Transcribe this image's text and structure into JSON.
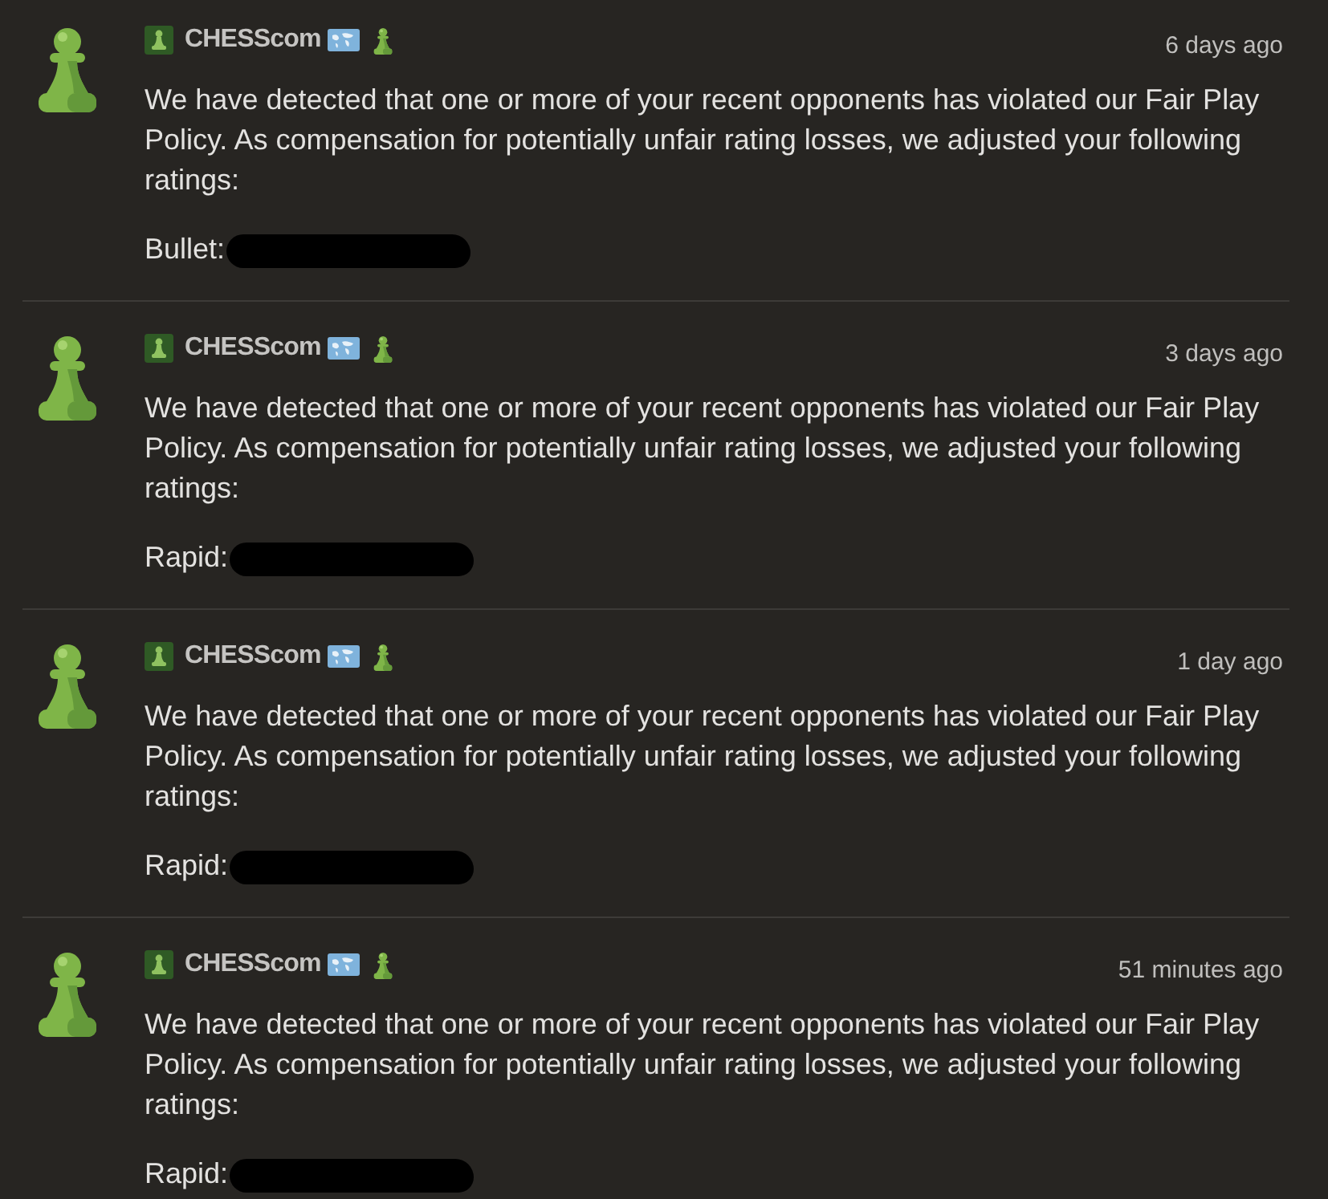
{
  "messages": [
    {
      "sender": "CHESScom",
      "time": "6 days ago",
      "body": "We have detected that one or more of your recent opponents has violated our Fair Play Policy. As compensation for potentially unfair rating losses, we adjusted your following ratings:",
      "rating_label": "Bullet:"
    },
    {
      "sender": "CHESScom",
      "time": "3 days ago",
      "body": "We have detected that one or more of your recent opponents has violated our Fair Play Policy. As compensation for potentially unfair rating losses, we adjusted your following ratings:",
      "rating_label": "Rapid:"
    },
    {
      "sender": "CHESScom",
      "time": "1 day ago",
      "body": "We have detected that one or more of your recent opponents has violated our Fair Play Policy. As compensation for potentially unfair rating losses, we adjusted your following ratings:",
      "rating_label": "Rapid:"
    },
    {
      "sender": "CHESScom",
      "time": "51 minutes ago",
      "body": "We have detected that one or more of your recent opponents has violated our Fair Play Policy. As compensation for potentially unfair rating losses, we adjusted your following ratings:",
      "rating_label": "Rapid:"
    }
  ]
}
